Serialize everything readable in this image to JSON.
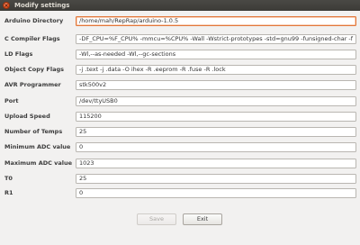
{
  "window": {
    "title": "Modify settings",
    "close_symbol": "×"
  },
  "fields": [
    {
      "label": "Arduino Directory",
      "value": "/home/mah/RepRap/arduino-1.0.5"
    },
    {
      "label": "C Compiler Flags",
      "value": "-DF_CPU=%F_CPU% -mmcu=%CPU% -Wall -Wstrict-prototypes -std=gnu99 -funsigned-char -f"
    },
    {
      "label": "LD Flags",
      "value": "-Wl,--as-needed -Wl,--gc-sections"
    },
    {
      "label": "Object Copy Flags",
      "value": "-j .text -j .data -O ihex -R .eeprom -R .fuse -R .lock"
    },
    {
      "label": "AVR Programmer",
      "value": "stk500v2"
    },
    {
      "label": "Port",
      "value": "/dev/ttyUSB0"
    },
    {
      "label": "Upload Speed",
      "value": "115200"
    },
    {
      "label": "Number of Temps",
      "value": "25"
    },
    {
      "label": "Minimum ADC value",
      "value": "0"
    },
    {
      "label": "Maximum ADC value",
      "value": "1023"
    },
    {
      "label": "T0",
      "value": "25"
    },
    {
      "label": "R1",
      "value": "0"
    }
  ],
  "buttons": {
    "save_label": "Save",
    "exit_label": "Exit"
  }
}
